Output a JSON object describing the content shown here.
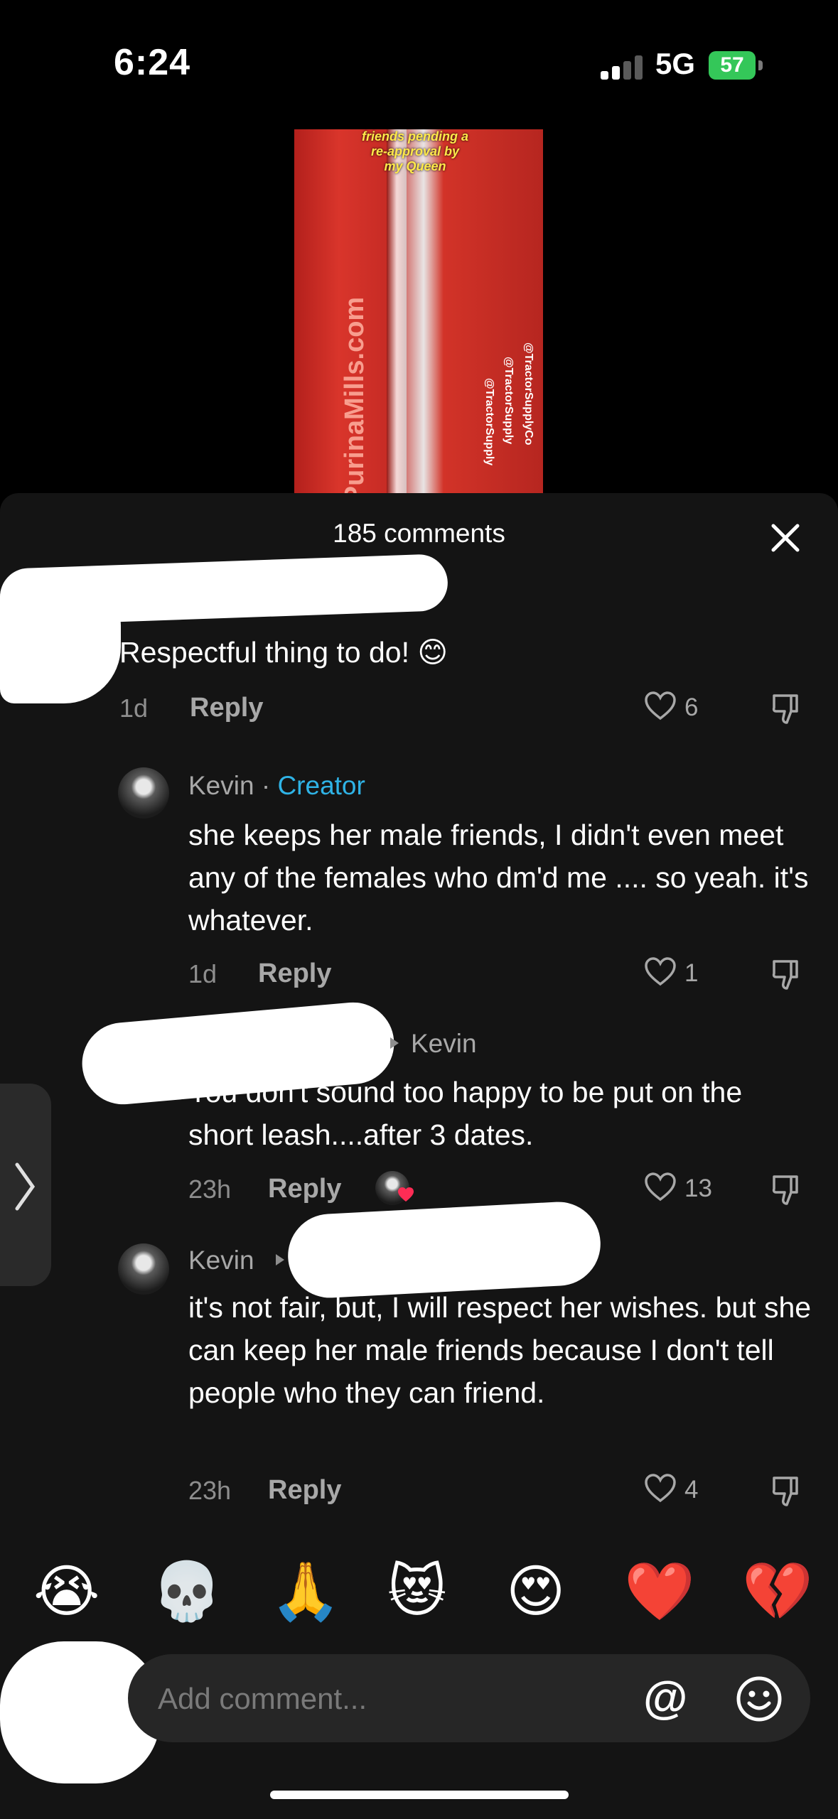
{
  "status_bar": {
    "time": "6:24",
    "network": "5G",
    "battery": "57"
  },
  "video": {
    "overlay_text": "friends pending a re-approval by my Queen",
    "brand_text": "PurinaMills.com",
    "handles": [
      "@TractorSupplyCo",
      "@TractorSupply",
      "@TractorSupply"
    ]
  },
  "comments_sheet": {
    "title": "185 comments",
    "comments": [
      {
        "text": "Respectful thing to do! 😊",
        "time": "1d",
        "reply_label": "Reply",
        "likes": "6"
      },
      {
        "author": "Kevin",
        "separator": "·",
        "badge": "Creator",
        "text": "she keeps her male friends, I didn't even meet any of the females who dm'd me .... so yeah. it's whatever.",
        "time": "1d",
        "reply_label": "Reply",
        "likes": "1"
      },
      {
        "reply_to": "Kevin",
        "text": "You don't sound too happy to be put on the short leash....after 3 dates.",
        "time": "23h",
        "reply_label": "Reply",
        "likes": "13"
      },
      {
        "author": "Kevin",
        "text": "it's not fair, but, I will respect her wishes. but she can keep her male friends because I don't tell people who they can friend.",
        "time": "23h",
        "reply_label": "Reply",
        "likes": "4"
      }
    ]
  },
  "emoji_bar": [
    "😭",
    "💀",
    "🙏",
    "😻",
    "😍",
    "❤️",
    "💔"
  ],
  "comment_input": {
    "placeholder": "Add comment..."
  },
  "colors": {
    "accent_creator": "#2fb3e6",
    "sheet_bg": "#141414",
    "battery": "#34c759"
  }
}
